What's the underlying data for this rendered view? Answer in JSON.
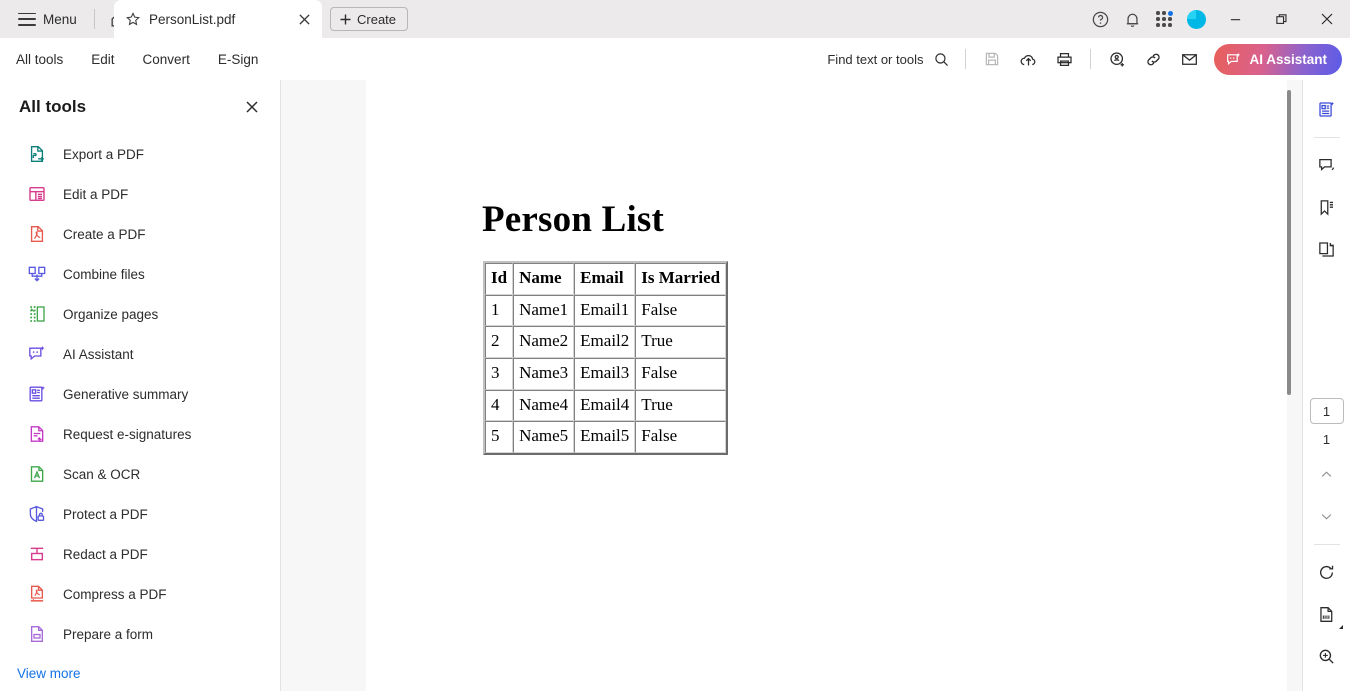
{
  "titlebar": {
    "menu_label": "Menu",
    "home_icon": "home-icon",
    "tab": {
      "title": "PersonList.pdf",
      "star_icon": "star-icon",
      "close_icon": "close-icon"
    },
    "create_label": "Create",
    "right_icons": [
      "help-circle-icon",
      "bell-icon",
      "app-grid-icon",
      "avatar"
    ],
    "window_controls": [
      "minimize",
      "restore",
      "close"
    ]
  },
  "menustrip": {
    "tabs": [
      {
        "label": "All tools"
      },
      {
        "label": "Edit"
      },
      {
        "label": "Convert"
      },
      {
        "label": "E-Sign"
      }
    ],
    "find_placeholder": "Find text or tools",
    "quick_icons": [
      "search-icon",
      "save-icon",
      "upload-cloud-icon",
      "print-icon",
      "add-stamp-icon",
      "link-icon",
      "mail-icon"
    ],
    "ai_assistant_label": "AI Assistant",
    "ai_gradient_from": "#e8605a",
    "ai_gradient_to": "#5b5be8"
  },
  "left_panel": {
    "title": "All tools",
    "close_icon": "close-icon",
    "view_more_label": "View more",
    "items": [
      {
        "label": "Export a PDF",
        "icon": "export-pdf-icon",
        "color": "#0d8079"
      },
      {
        "label": "Edit a PDF",
        "icon": "edit-pdf-icon",
        "color": "#d83b8e"
      },
      {
        "label": "Create a PDF",
        "icon": "create-pdf-icon",
        "color": "#e8584c"
      },
      {
        "label": "Combine files",
        "icon": "combine-files-icon",
        "color": "#5a5ae0"
      },
      {
        "label": "Organize pages",
        "icon": "organize-pages-icon",
        "color": "#3fa64a"
      },
      {
        "label": "AI Assistant",
        "icon": "ai-assistant-icon",
        "color": "#6a4ce0"
      },
      {
        "label": "Generative summary",
        "icon": "generative-summary-icon",
        "color": "#6a4ce0"
      },
      {
        "label": "Request e-signatures",
        "icon": "request-esign-icon",
        "color": "#c438c4"
      },
      {
        "label": "Scan & OCR",
        "icon": "scan-ocr-icon",
        "color": "#3fa64a"
      },
      {
        "label": "Protect a PDF",
        "icon": "protect-pdf-icon",
        "color": "#5a5ae0"
      },
      {
        "label": "Redact a PDF",
        "icon": "redact-pdf-icon",
        "color": "#d83b8e"
      },
      {
        "label": "Compress a PDF",
        "icon": "compress-pdf-icon",
        "color": "#e8584c"
      },
      {
        "label": "Prepare a form",
        "icon": "prepare-form-icon",
        "color": "#a86ad8"
      }
    ]
  },
  "palette": {
    "tools": [
      {
        "icon": "selection-cursor-icon",
        "active": true
      },
      {
        "icon": "add-comment-icon",
        "active": false
      },
      {
        "icon": "highlighter-icon",
        "active": false
      },
      {
        "icon": "draw-lasso-icon",
        "active": false
      },
      {
        "icon": "select-text-icon",
        "active": false
      },
      {
        "icon": "sign-pen-icon",
        "active": false
      }
    ],
    "active_color": "#1473e6"
  },
  "document": {
    "title": "Person List",
    "table": {
      "headers": [
        "Id",
        "Name",
        "Email",
        "Is Married"
      ],
      "rows": [
        [
          "1",
          "Name1",
          "Email1",
          "False"
        ],
        [
          "2",
          "Name2",
          "Email2",
          "True"
        ],
        [
          "3",
          "Name3",
          "Email3",
          "False"
        ],
        [
          "4",
          "Name4",
          "Email4",
          "True"
        ],
        [
          "5",
          "Name5",
          "Email5",
          "False"
        ]
      ]
    }
  },
  "right_rail": {
    "top_icons": [
      "generative-summary-icon",
      "comment-icon",
      "bookmark-icon",
      "page-thumbnails-icon"
    ],
    "current_page": "1",
    "total_pages": "1",
    "nav_icons": [
      "chevron-up-icon",
      "chevron-down-icon"
    ],
    "bottom_icons": [
      "rotate-icon",
      "fit-page-icon",
      "zoom-icon"
    ]
  }
}
